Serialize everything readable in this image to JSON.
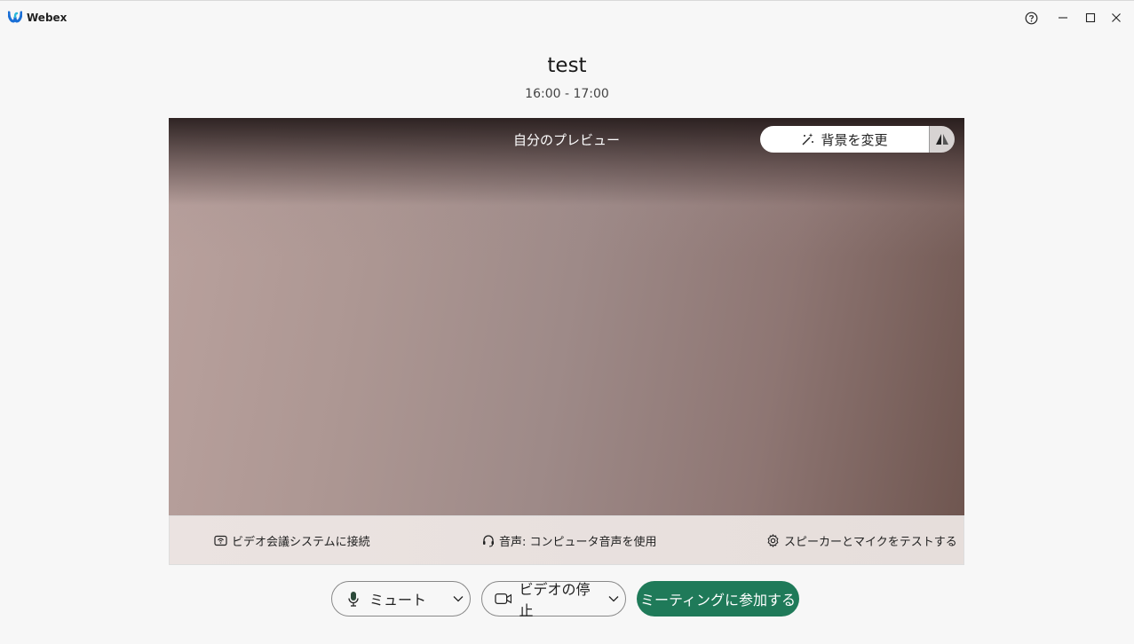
{
  "app": {
    "name": "Webex"
  },
  "window_controls": {
    "help": "help-icon",
    "minimize": "minimize-icon",
    "maximize": "maximize-icon",
    "close": "close-icon"
  },
  "meeting": {
    "title": "test",
    "time": "16:00 - 17:00"
  },
  "preview": {
    "label": "自分のプレビュー",
    "change_background": "背景を変更"
  },
  "options": {
    "video_system": "ビデオ会議システムに接続",
    "audio": "音声: コンピュータ音声を使用",
    "test": "スピーカーとマイクをテストする"
  },
  "controls": {
    "mute": "ミュート",
    "stop_video": "ビデオの停止",
    "join": "ミーティングに参加する"
  },
  "colors": {
    "join_button": "#1f7a59",
    "background": "#f7f7f7",
    "logo_blue": "#1a6fd6",
    "logo_cyan": "#2bb8d9"
  }
}
